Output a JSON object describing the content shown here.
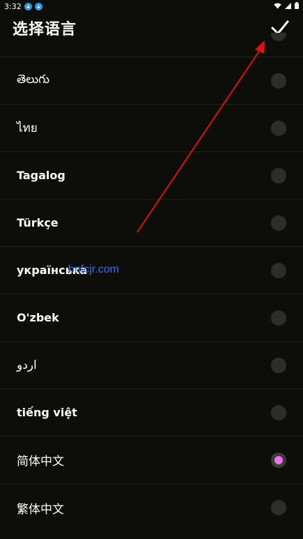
{
  "status_bar": {
    "time": "3:32",
    "icons": [
      "download-icon",
      "download-icon",
      "wifi-icon",
      "signal-icon",
      "battery-icon"
    ]
  },
  "header": {
    "title": "选择语言",
    "confirm_icon": "checkmark-icon"
  },
  "languages": [
    {
      "label": "తెలుగు",
      "selected": false
    },
    {
      "label": "ไทย",
      "selected": false
    },
    {
      "label": "Tagalog",
      "selected": false
    },
    {
      "label": "Türkçe",
      "selected": false
    },
    {
      "label": "українська",
      "selected": false
    },
    {
      "label": "O'zbek",
      "selected": false
    },
    {
      "label": "اردو",
      "selected": false
    },
    {
      "label": "tiếng việt",
      "selected": false
    },
    {
      "label": "简体中文",
      "selected": true
    },
    {
      "label": "繁体中文",
      "selected": false
    }
  ],
  "watermark": "bnfcjr.com",
  "colors": {
    "background": "#0d0d0a",
    "radio": "#2d2d29",
    "selected_dot": "#f06ef0",
    "annotation_arrow": "#e01010",
    "watermark": "#2f6ff0"
  }
}
